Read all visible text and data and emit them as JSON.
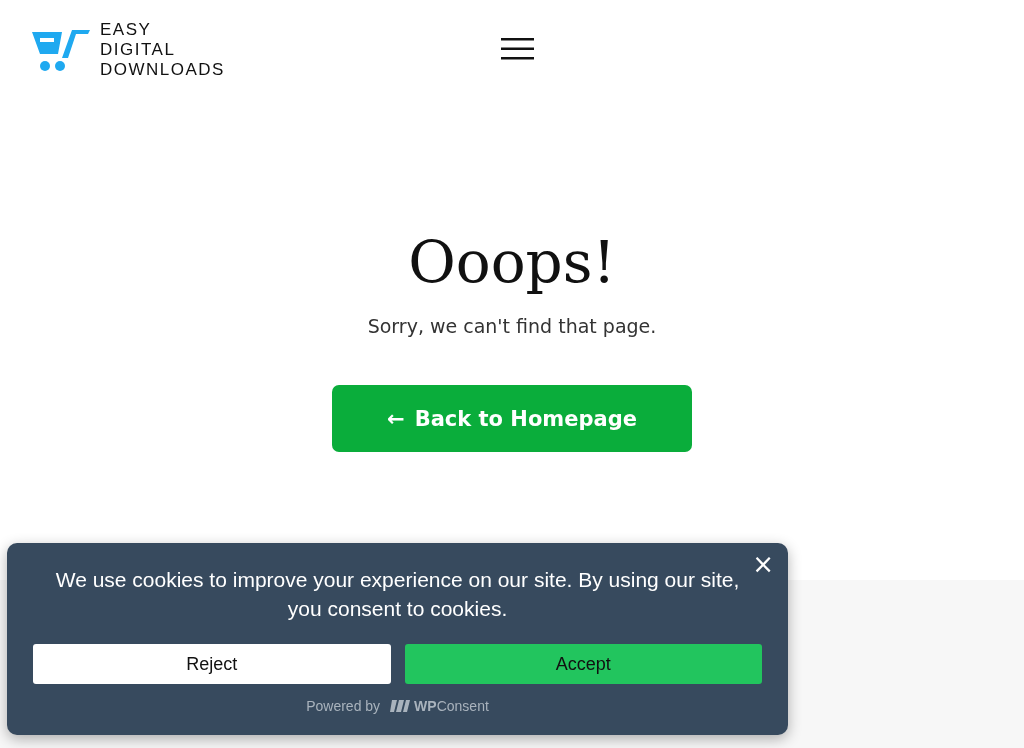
{
  "header": {
    "logo_text": [
      "EASY",
      "DIGITAL",
      "DOWNLOADS"
    ]
  },
  "error": {
    "title": "Ooops!",
    "message": "Sorry, we can't find that page.",
    "button": {
      "icon": "←",
      "label": "Back to Homepage"
    }
  },
  "cookie_banner": {
    "message": "We use cookies to improve your experience on our site. By using our site, you consent to cookies.",
    "close": "×",
    "buttons": [
      {
        "label": "Reject",
        "kind": "secondary"
      },
      {
        "label": "Accept",
        "kind": "primary"
      }
    ],
    "powered_by": "Powered by",
    "brand": "**WP**Consent"
  }
}
